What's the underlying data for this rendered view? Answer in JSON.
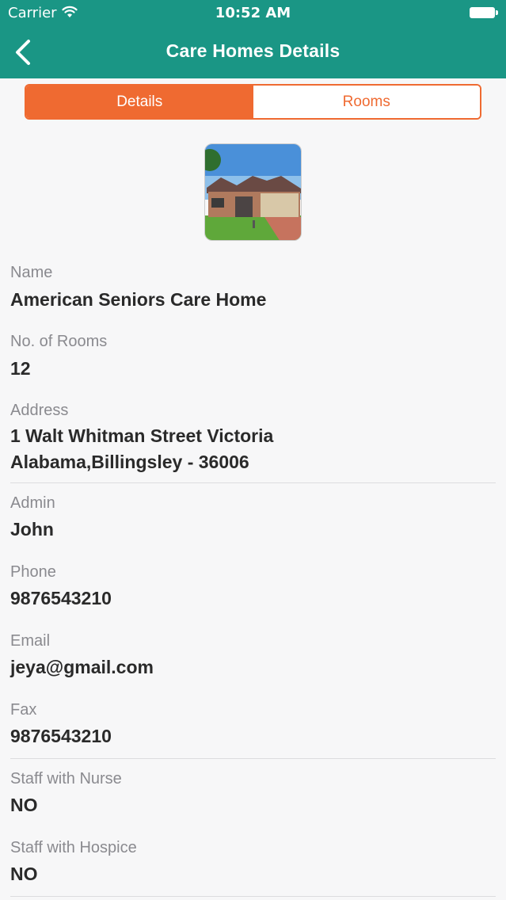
{
  "status_bar": {
    "carrier": "Carrier",
    "time": "10:52 AM"
  },
  "header": {
    "title": "Care Homes Details"
  },
  "tabs": [
    {
      "label": "Details",
      "active": true
    },
    {
      "label": "Rooms",
      "active": false
    }
  ],
  "colors": {
    "header": "#1a9685",
    "accent": "#ef6a31"
  },
  "details": {
    "name_label": "Name",
    "name_value": "American Seniors Care Home",
    "rooms_label": "No. of Rooms",
    "rooms_value": "12",
    "address_label": "Address",
    "address_line1": "1 Walt Whitman Street  Victoria",
    "address_line2": "Alabama,Billingsley - 36006",
    "admin_label": "Admin",
    "admin_value": "John",
    "phone_label": "Phone",
    "phone_value": "9876543210",
    "email_label": "Email",
    "email_value": "jeya@gmail.com",
    "fax_label": "Fax",
    "fax_value": "9876543210",
    "nurse_label": "Staff with Nurse",
    "nurse_value": "NO",
    "hospice_label": "Staff with Hospice",
    "hospice_value": "NO"
  }
}
